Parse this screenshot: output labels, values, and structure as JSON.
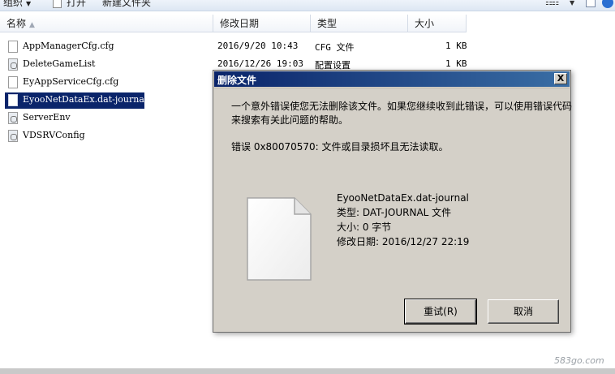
{
  "toolbar": {
    "organize_label": "组织",
    "open_label": "打开",
    "new_folder_label": "新建文件夹"
  },
  "columns": {
    "name": "名称",
    "modified": "修改日期",
    "type": "类型",
    "size": "大小"
  },
  "files": [
    {
      "name": "AppManagerCfg.cfg",
      "modified": "2016/9/20 10:43",
      "type": "CFG 文件",
      "size": "1 KB",
      "icon": "document-icon"
    },
    {
      "name": "DeleteGameList",
      "modified": "2016/12/26 19:03",
      "type": "配置设置",
      "size": "1 KB",
      "icon": "settings-file-icon"
    },
    {
      "name": "EyAppServiceCfg.cfg",
      "modified": "",
      "type": "",
      "size": "",
      "icon": "document-icon"
    },
    {
      "name": "EyooNetDataEx.dat-journal",
      "modified": "",
      "type": "",
      "size": "",
      "icon": "document-icon",
      "selected": true
    },
    {
      "name": "ServerEnv",
      "modified": "",
      "type": "",
      "size": "",
      "icon": "settings-file-icon"
    },
    {
      "name": "VDSRVConfig",
      "modified": "",
      "type": "",
      "size": "",
      "icon": "settings-file-icon"
    }
  ],
  "dialog": {
    "title": "删除文件",
    "close_label": "X",
    "message": "一个意外错误使您无法删除该文件。如果您继续收到此错误，可以使用错误代码来搜索有关此问题的帮助。",
    "error": "错误 0x80070570: 文件或目录损坏且无法读取。",
    "file": {
      "name": "EyooNetDataEx.dat-journal",
      "type": "类型: DAT-JOURNAL 文件",
      "size": "大小: 0 字节",
      "modified": "修改日期: 2016/12/27 22:19"
    },
    "retry_label": "重试(R)",
    "cancel_label": "取消"
  },
  "watermark": "583go.com",
  "colors": {
    "selection": "#0a246a",
    "titlebar_start": "#0a246a",
    "titlebar_end": "#3a6ea5",
    "dialog_bg": "#d4d0c8"
  }
}
